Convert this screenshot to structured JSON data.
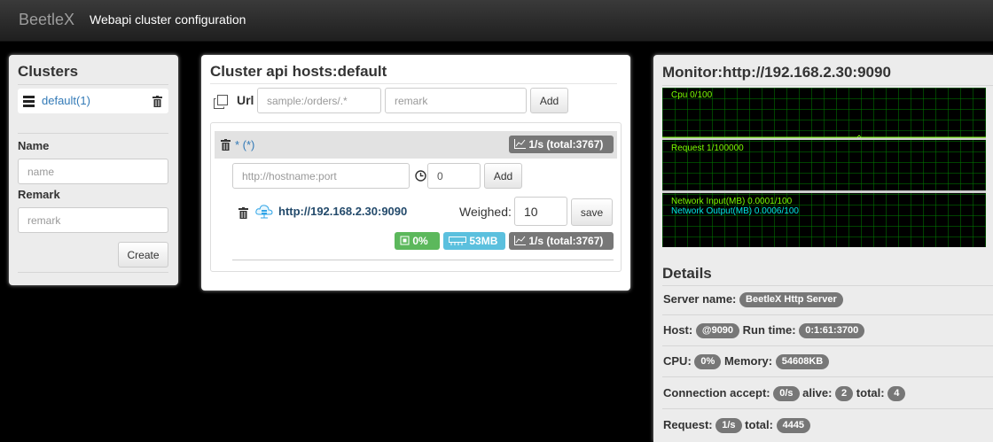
{
  "navbar": {
    "brand": "BeetleX",
    "title": "Webapi cluster configuration"
  },
  "clusters": {
    "title": "Clusters",
    "items": [
      {
        "label": "default(1)"
      }
    ],
    "name_label": "Name",
    "name_placeholder": "name",
    "remark_label": "Remark",
    "remark_placeholder": "remark",
    "create_label": "Create"
  },
  "hosts": {
    "title": "Cluster api hosts:default",
    "url_label": "Url",
    "url_placeholder": "sample:/orders/.*",
    "remark_placeholder": "remark",
    "add_label": "Add",
    "route": {
      "pattern": "* (*)",
      "stats": "1/s (total:3767)",
      "host_placeholder": "http://hostname:port",
      "weight_value": "0",
      "add_label": "Add",
      "server": {
        "url": "http://192.168.2.30:9090",
        "weighed_label": "Weighed:",
        "weighed_value": "10",
        "save_label": "save",
        "cpu": "0%",
        "memory": "53MB",
        "stats": "1/s (total:3767)"
      }
    }
  },
  "monitor": {
    "title": "Monitor:http://192.168.2.30:9090",
    "cpu_label": "Cpu 0/100",
    "request_label": "Request 1/100000",
    "net_input_label": "Network Input(MB) 0.0001/100",
    "net_output_label": "Network Output(MB) 0.0006/100",
    "colors": {
      "cpu": "#7cfc00",
      "request": "#7cfc00",
      "net_input": "#7cfc00",
      "net_output": "#00e5e5"
    }
  },
  "details": {
    "title": "Details",
    "server_name_label": "Server name:",
    "server_name": "BeetleX Http Server",
    "host_label": "Host:",
    "host": "@9090",
    "run_time_label": "Run time:",
    "run_time": "0:1:61:3700",
    "cpu_label": "CPU:",
    "cpu": "0%",
    "memory_label": "Memory:",
    "memory": "54608KB",
    "conn_label": "Connection accept:",
    "conn_accept": "0/s",
    "alive_label": "alive:",
    "alive": "2",
    "total_label": "total:",
    "conn_total": "4",
    "request_label": "Request:",
    "request_rate": "1/s",
    "request_total_label": "total:",
    "request_total": "4445"
  }
}
